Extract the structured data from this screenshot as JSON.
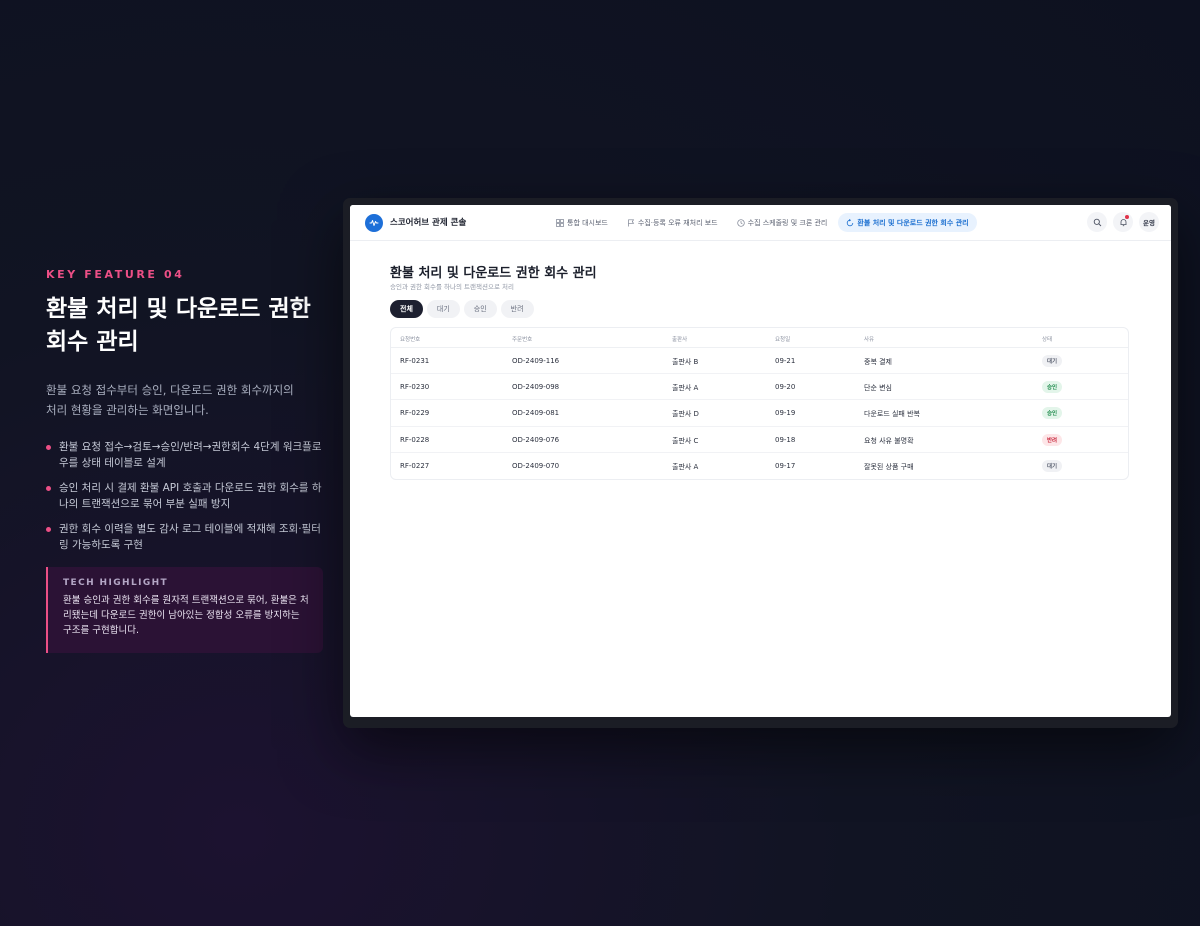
{
  "feature": {
    "kicker": "KEY FEATURE 04",
    "title_line1": "환불 처리 및 다운로드 권한",
    "title_line2": "회수 관리",
    "description": "환불 요청 접수부터 승인, 다운로드 권한 회수까지의 처리 현황을 관리하는 화면입니다.",
    "bullets": [
      "환불 요청 접수→검토→승인/반려→권한회수 4단계 워크플로우를 상태 테이블로 설계",
      "승인 처리 시 결제 환불 API 호출과 다운로드 권한 회수를 하나의 트랜잭션으로 묶어 부분 실패 방지",
      "권한 회수 이력을 별도 감사 로그 테이블에 적재해 조회·필터링 가능하도록 구현"
    ],
    "tech_label": "TECH HIGHLIGHT",
    "tech_text": "환불 승인과 권한 회수를 원자적 트랜잭션으로 묶어, 환불은 처리됐는데 다운로드 권한이 남아있는 정합성 오류를 방지하는 구조를 구현합니다."
  },
  "app": {
    "brand": "스코어허브 관제 콘솔",
    "nav": [
      {
        "label": "통합 대시보드",
        "icon": "grid-icon"
      },
      {
        "label": "수집·등록 오류 재처리 보드",
        "icon": "flag-icon"
      },
      {
        "label": "수집 스케줄링 및 크론 관리",
        "icon": "clock-icon"
      },
      {
        "label": "환불 처리 및 다운로드 권한 회수 관리",
        "icon": "refresh-icon"
      }
    ],
    "user": "운영"
  },
  "page": {
    "title": "환불 처리 및 다운로드 권한 회수 관리",
    "subtitle": "승인과 권한 회수를 하나의 트랜잭션으로 처리",
    "filters": [
      "전체",
      "대기",
      "승인",
      "반려"
    ],
    "columns": [
      "요청번호",
      "주문번호",
      "출판사",
      "요청일",
      "사유",
      "상태"
    ],
    "rows": [
      {
        "id": "RF-0231",
        "order": "OD-2409-116",
        "publisher": "출판사 B",
        "date": "09-21",
        "reason": "중복 결제",
        "status": "대기"
      },
      {
        "id": "RF-0230",
        "order": "OD-2409-098",
        "publisher": "출판사 A",
        "date": "09-20",
        "reason": "단순 변심",
        "status": "승인"
      },
      {
        "id": "RF-0229",
        "order": "OD-2409-081",
        "publisher": "출판사 D",
        "date": "09-19",
        "reason": "다운로드 실패 반복",
        "status": "승인"
      },
      {
        "id": "RF-0228",
        "order": "OD-2409-076",
        "publisher": "출판사 C",
        "date": "09-18",
        "reason": "요청 사유 불명확",
        "status": "반려"
      },
      {
        "id": "RF-0227",
        "order": "OD-2409-070",
        "publisher": "출판사 A",
        "date": "09-17",
        "reason": "잘못된 상품 구매",
        "status": "대기"
      }
    ]
  },
  "colors": {
    "accent_pink": "#ec4f86",
    "brand_blue": "#1d6fd8",
    "status_wait": "#5a6070",
    "status_approved": "#1f8a4c",
    "status_rejected": "#c9283d"
  }
}
